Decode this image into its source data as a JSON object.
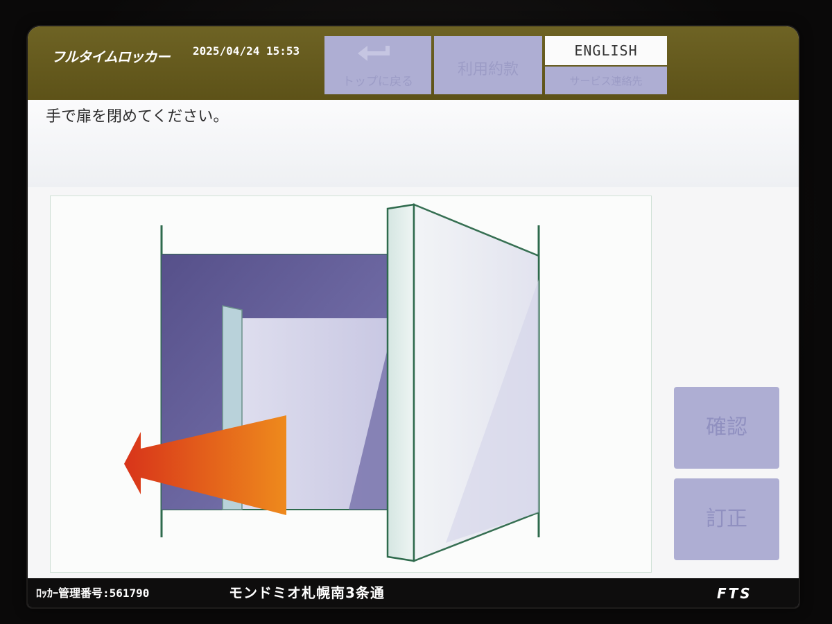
{
  "header": {
    "logo": "フルタイムロッカー",
    "datetime": "2025/04/24 15:53",
    "back_to_top_label": "トップに戻る",
    "terms_label": "利用約款",
    "english_label": "ENGLISH",
    "service_contact_label": "サービス連絡先"
  },
  "main": {
    "instruction": "手で扉を閉めてください。"
  },
  "side_buttons": {
    "confirm_label": "確認",
    "correct_label": "訂正"
  },
  "footer": {
    "locker_number": "ﾛｯｶｰ管理番号:561790",
    "location": "モンドミオ札幌南3条通",
    "brand": "FTS"
  },
  "colors": {
    "header_bg": "#5f5419",
    "disabled_button": "#aeaed3",
    "arrow_orange": "#e86a18",
    "locker_purple": "#5a5490",
    "outline_green": "#3a7a5a"
  },
  "icons": {
    "back": "return-arrow-icon",
    "illustration": "close-door-illustration",
    "direction": "close-direction-arrow"
  }
}
